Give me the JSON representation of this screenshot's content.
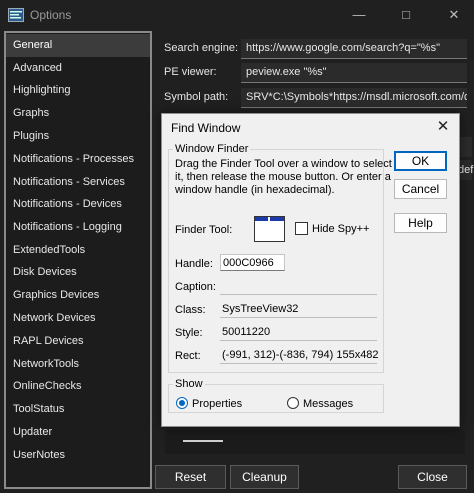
{
  "window": {
    "title": "Options"
  },
  "sidebar": {
    "items": [
      {
        "label": "General",
        "selected": true
      },
      {
        "label": "Advanced"
      },
      {
        "label": "Highlighting"
      },
      {
        "label": "Graphs"
      },
      {
        "label": "Plugins"
      },
      {
        "label": "Notifications - Processes"
      },
      {
        "label": "Notifications - Services"
      },
      {
        "label": "Notifications - Devices"
      },
      {
        "label": "Notifications - Logging"
      },
      {
        "label": "ExtendedTools"
      },
      {
        "label": "Disk Devices"
      },
      {
        "label": "Graphics Devices"
      },
      {
        "label": "Network Devices"
      },
      {
        "label": "RAPL Devices"
      },
      {
        "label": "NetworkTools"
      },
      {
        "label": "OnlineChecks"
      },
      {
        "label": "ToolStatus"
      },
      {
        "label": "Updater"
      },
      {
        "label": "UserNotes"
      }
    ]
  },
  "general": {
    "search_engine_label": "Search engine:",
    "search_engine_value": "https://www.google.com/search?q=\"%s\"",
    "pe_viewer_label": "PE viewer:",
    "pe_viewer_value": "peview.exe \"%s\"",
    "symbol_path_label": "Symbol path:",
    "symbol_path_value": "SRV*C:\\Symbols*https://msdl.microsoft.com/d",
    "partial_text": "def"
  },
  "buttons": {
    "reset": "Reset",
    "cleanup": "Cleanup",
    "close": "Close"
  },
  "find_window": {
    "title": "Find Window",
    "window_finder_legend": "Window Finder",
    "description": "Drag the Finder Tool over a window to select it, then release the mouse button.  Or enter a window handle (in hexadecimal).",
    "finder_tool_label": "Finder Tool:",
    "hide_spy_label": "Hide Spy++",
    "hide_spy_checked": false,
    "handle_label": "Handle:",
    "handle_value": "000C0966",
    "caption_label": "Caption:",
    "caption_value": "",
    "class_label": "Class:",
    "class_value": "SysTreeView32",
    "style_label": "Style:",
    "style_value": "50011220",
    "rect_label": "Rect:",
    "rect_value": "(-991, 312)-(-836, 794) 155x482",
    "show_legend": "Show",
    "properties_label": "Properties",
    "messages_label": "Messages",
    "selected_show": "Properties",
    "ok": "OK",
    "cancel": "Cancel",
    "help": "Help"
  }
}
